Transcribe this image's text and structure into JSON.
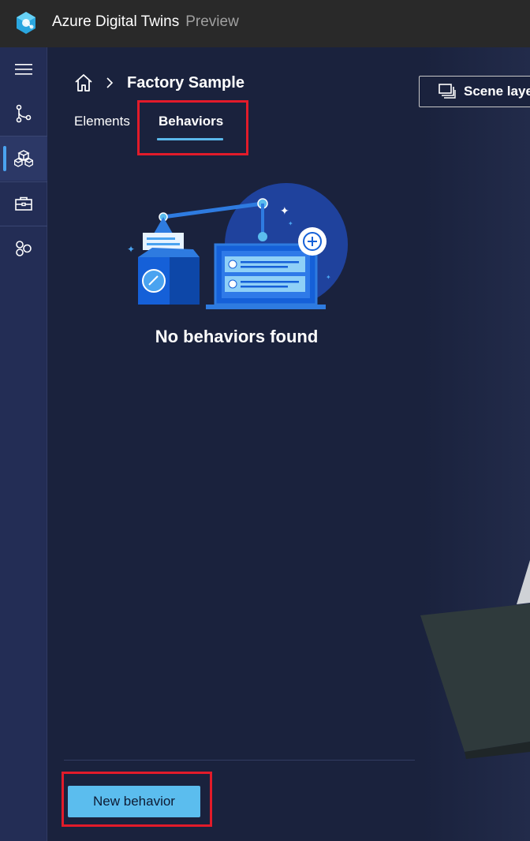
{
  "app": {
    "title": "Azure Digital Twins",
    "badge": "Preview",
    "logo_icon": "azure-digital-twins-logo"
  },
  "nav": {
    "items": [
      {
        "name": "menu",
        "icon": "hamburger-icon"
      },
      {
        "name": "twin-graph",
        "icon": "graph-icon"
      },
      {
        "name": "scenes",
        "icon": "cubes-icon",
        "active": true
      },
      {
        "name": "toolkit",
        "icon": "briefcase-icon"
      },
      {
        "name": "models",
        "icon": "models-icon"
      }
    ]
  },
  "breadcrumb": {
    "home_icon": "home-icon",
    "title": "Factory Sample"
  },
  "scene_layers": {
    "label": "Scene laye"
  },
  "tabs": [
    {
      "label": "Elements",
      "active": false
    },
    {
      "label": "Behaviors",
      "active": true
    }
  ],
  "empty_state": {
    "message": "No behaviors found"
  },
  "actions": {
    "new_behavior_label": "New behavior"
  },
  "colors": {
    "topbar": "#292929",
    "nav": "#232d55",
    "main": "#1a223d",
    "accent": "#5bbdee",
    "highlight": "#e21b2a"
  }
}
